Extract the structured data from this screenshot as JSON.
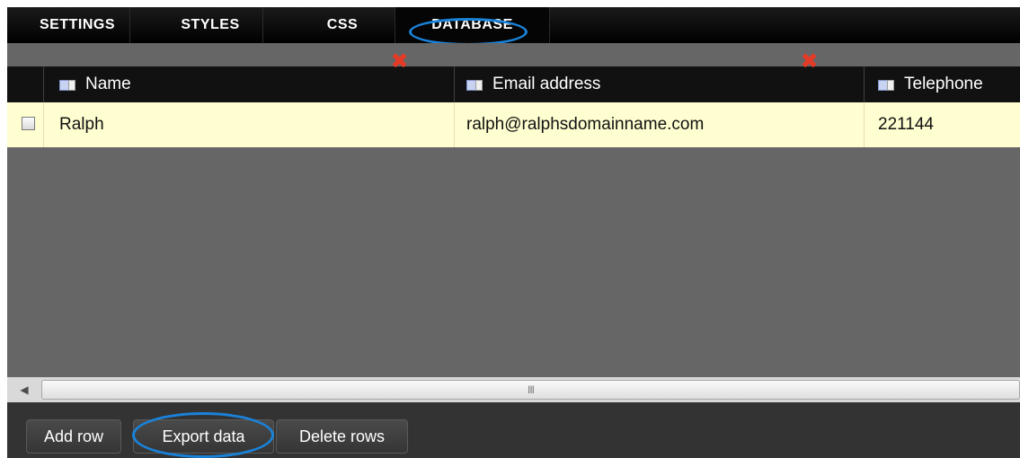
{
  "tabs": [
    {
      "label": "SETTINGS",
      "active": false
    },
    {
      "label": "STYLES",
      "active": false
    },
    {
      "label": "CSS",
      "active": false
    },
    {
      "label": "DATABASE",
      "active": true
    }
  ],
  "grid": {
    "columns": [
      {
        "label": "Name",
        "icon": "column-icon",
        "delete_icon": "delete-x-icon"
      },
      {
        "label": "Email address",
        "icon": "column-icon",
        "delete_icon": "delete-x-icon"
      },
      {
        "label": "Telephone",
        "icon": "column-icon"
      }
    ],
    "rows": [
      {
        "checked": false,
        "cells": [
          "Ralph",
          "ralph@ralphsdomainname.com",
          "221144"
        ]
      }
    ]
  },
  "scrollbar": {
    "left_arrow": "◀",
    "grip": "III"
  },
  "buttons": {
    "add_row": "Add row",
    "export_data": "Export data",
    "delete_rows": "Delete rows"
  },
  "colors": {
    "highlight": "#1a82d9",
    "row_background": "#fffed0",
    "delete_red": "#e53a26"
  }
}
